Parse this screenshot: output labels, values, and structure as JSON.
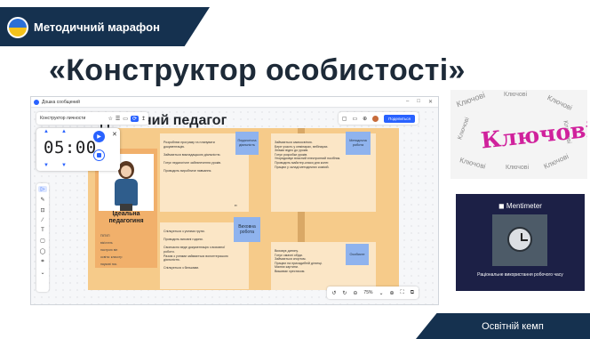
{
  "banner": {
    "title": "Методичний марафон"
  },
  "slide_title": "«Конструктор особистості»",
  "app": {
    "window_title": "Дошка сообщений",
    "window_buttons": [
      "–",
      "□",
      "✕"
    ],
    "board_name": "Конструктор личности",
    "toolbar_icons": [
      "☆",
      "☰",
      "▭",
      "⟳",
      "↥"
    ],
    "right_toolbar_icons": [
      "▢",
      "▭",
      "⊕"
    ],
    "share_button": "Поделиться",
    "board_heading": "деальний педагог",
    "timer": {
      "minutes": "05",
      "seconds": "00",
      "separator": ":"
    },
    "left_tools": [
      "▷",
      "✎",
      "⊡",
      "⁄",
      "T",
      "▢",
      "◯",
      "⌗",
      "⌄"
    ],
    "person_card": {
      "name_line1": "Ідеальна",
      "name_line2": "педагогиня",
      "fields": [
        "ПІП/ІП",
        "вік/стать",
        "настрою він",
        "освіта: класстр",
        "наукові пос.",
        "спеціально-педагог",
        "професія: ППФ"
      ]
    },
    "panels": [
      {
        "text": "Розроблює програму та планувати документацію.\n\nЗаймається викладацькою діяльністю.\n\nГотує педагогічне забезпечення уроків.\n\nПроводить виробниче навчання."
      },
      {
        "text": "Займається самоосвітою.\nБере участь у семінарах, вебінарах.\nЗнімає відео до уроків.\nГотує розробки уроків.\nУпорядковує власний електронний посібник.\nПроводить майстер-класи для колег.\nПрацює у складі методичних комісій."
      },
      {
        "text": "Спілкується з учнями групи.\n\nПроводить виховні години.\n\nСвоєчасно веде документацію з виховної роботи.\nРазом з учнями займається волонтерською діяльністю.\n\nСпілкується з батьками."
      },
      {
        "text": "Виховує дитину.\nГотує смачні обіди.\nЗаймається спортом.\nПрацює на присадибній ділянці.\nМалює картини.\nВишиває хрестиком."
      }
    ],
    "stickies": {
      "teaching": "Педагогічна діяльність",
      "methodical": "Методична робота",
      "educational": "Виховна робота",
      "personal": "Особисте"
    },
    "quote_mark": "„",
    "bottom_tools": [
      "↺",
      "↻",
      "⊖",
      "75%",
      "⌄",
      "⊕",
      "⛶",
      "⧉"
    ]
  },
  "word_cloud": {
    "main_word": "Ключові",
    "small_words": [
      "Ключові",
      "Ключові",
      "Ключові",
      "Ключові",
      "Ключові",
      "Ключові",
      "Ключові",
      "Ключові"
    ]
  },
  "mentimeter": {
    "brand": "Mentimeter",
    "caption": "Раціональне використання робочого часу"
  },
  "footer": {
    "label": "Освітній кемп"
  }
}
